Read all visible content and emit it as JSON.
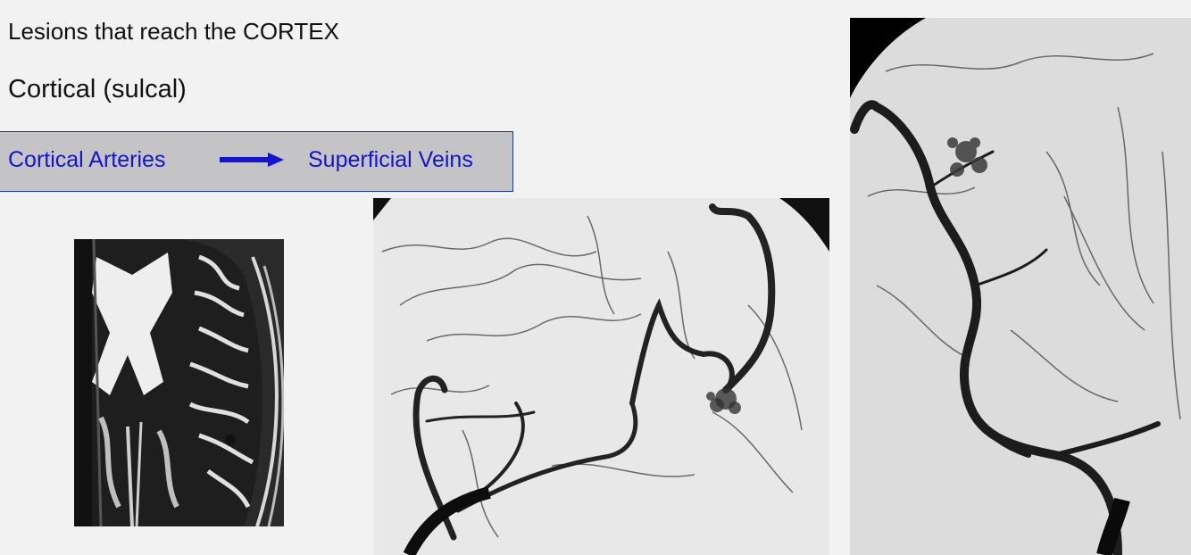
{
  "slide": {
    "heading": "Lesions that reach the CORTEX",
    "subheading": "Cortical (sulcal)",
    "flow": {
      "from": "Cortical Arteries",
      "to": "Superficial Veins",
      "arrow_icon": "right-arrow-icon",
      "text_color": "#1414cf",
      "box_fill": "#c4c4c6",
      "box_border": "#1a3aa0"
    }
  },
  "images": {
    "mri": {
      "icon": "brain-mri-axial-image"
    },
    "angiogram_lateral": {
      "icon": "cerebral-angiogram-lateral-image"
    },
    "angiogram_ap": {
      "icon": "cerebral-angiogram-frontal-image"
    }
  }
}
